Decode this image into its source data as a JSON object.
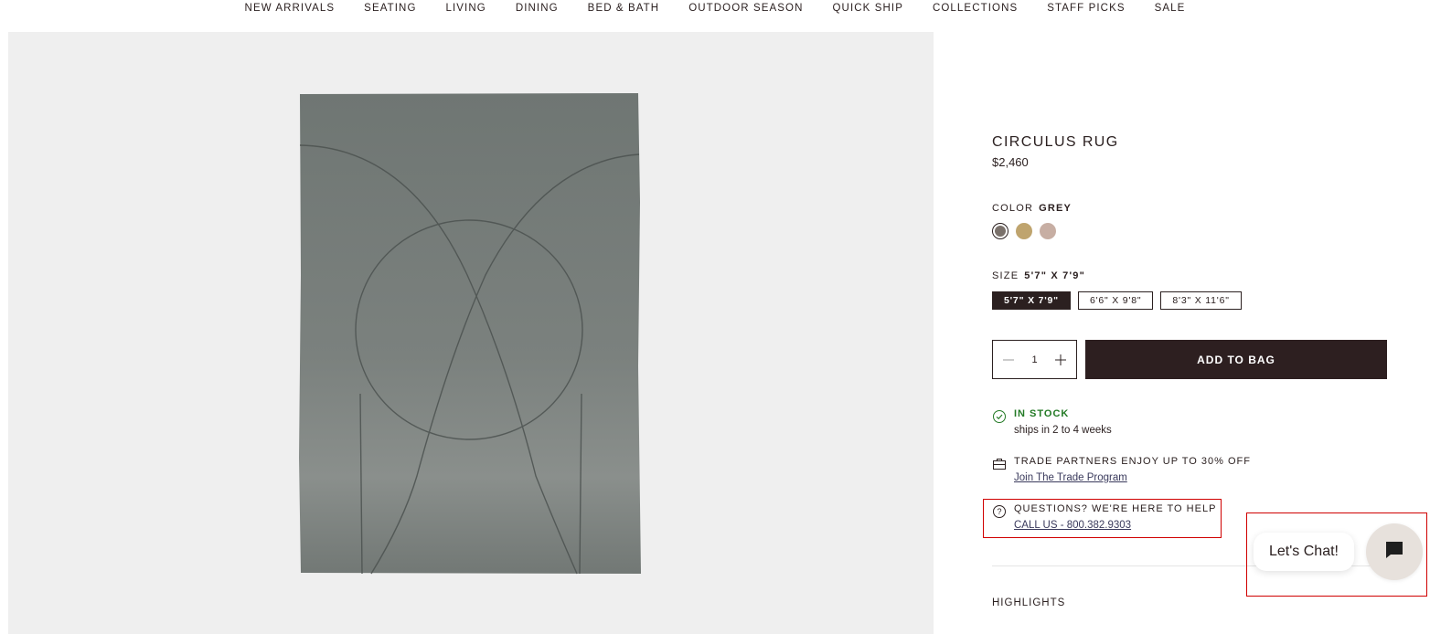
{
  "nav": [
    "NEW ARRIVALS",
    "SEATING",
    "LIVING",
    "DINING",
    "BED & BATH",
    "OUTDOOR SEASON",
    "QUICK SHIP",
    "COLLECTIONS",
    "STAFF PICKS",
    "SALE"
  ],
  "product": {
    "title": "CIRCULUS RUG",
    "price": "$2,460",
    "color_label": "COLOR",
    "color_selected": "GREY",
    "swatch_colors": [
      "#7a716b",
      "#bfa46e",
      "#c7aea3"
    ],
    "size_label": "SIZE",
    "size_selected": "5'7\" X 7'9\"",
    "sizes": [
      "5'7\" X 7'9\"",
      "6'6\" X 9'8\"",
      "8'3\" X 11'6\""
    ],
    "quantity": "1",
    "add_to_bag": "ADD TO BAG"
  },
  "stock": {
    "status": "IN STOCK",
    "ships": "ships in 2 to 4 weeks",
    "status_color": "#237a25"
  },
  "trade": {
    "text": "TRADE PARTNERS ENJOY UP TO 30% OFF",
    "link": "Join The Trade Program"
  },
  "help": {
    "text": "QUESTIONS? WE'RE HERE TO HELP",
    "link": "CALL US - 800.382.9303"
  },
  "highlights_label": "HIGHLIGHTS",
  "chat": {
    "label": "Let's Chat!"
  },
  "icons": {
    "stock": "check-circle-icon",
    "trade": "briefcase-icon",
    "help": "question-circle-icon",
    "chat": "chat-icon",
    "minus": "minus-icon",
    "plus": "plus-icon"
  },
  "colors": {
    "accent": "#2d1f20",
    "highlight": "#d00000"
  }
}
